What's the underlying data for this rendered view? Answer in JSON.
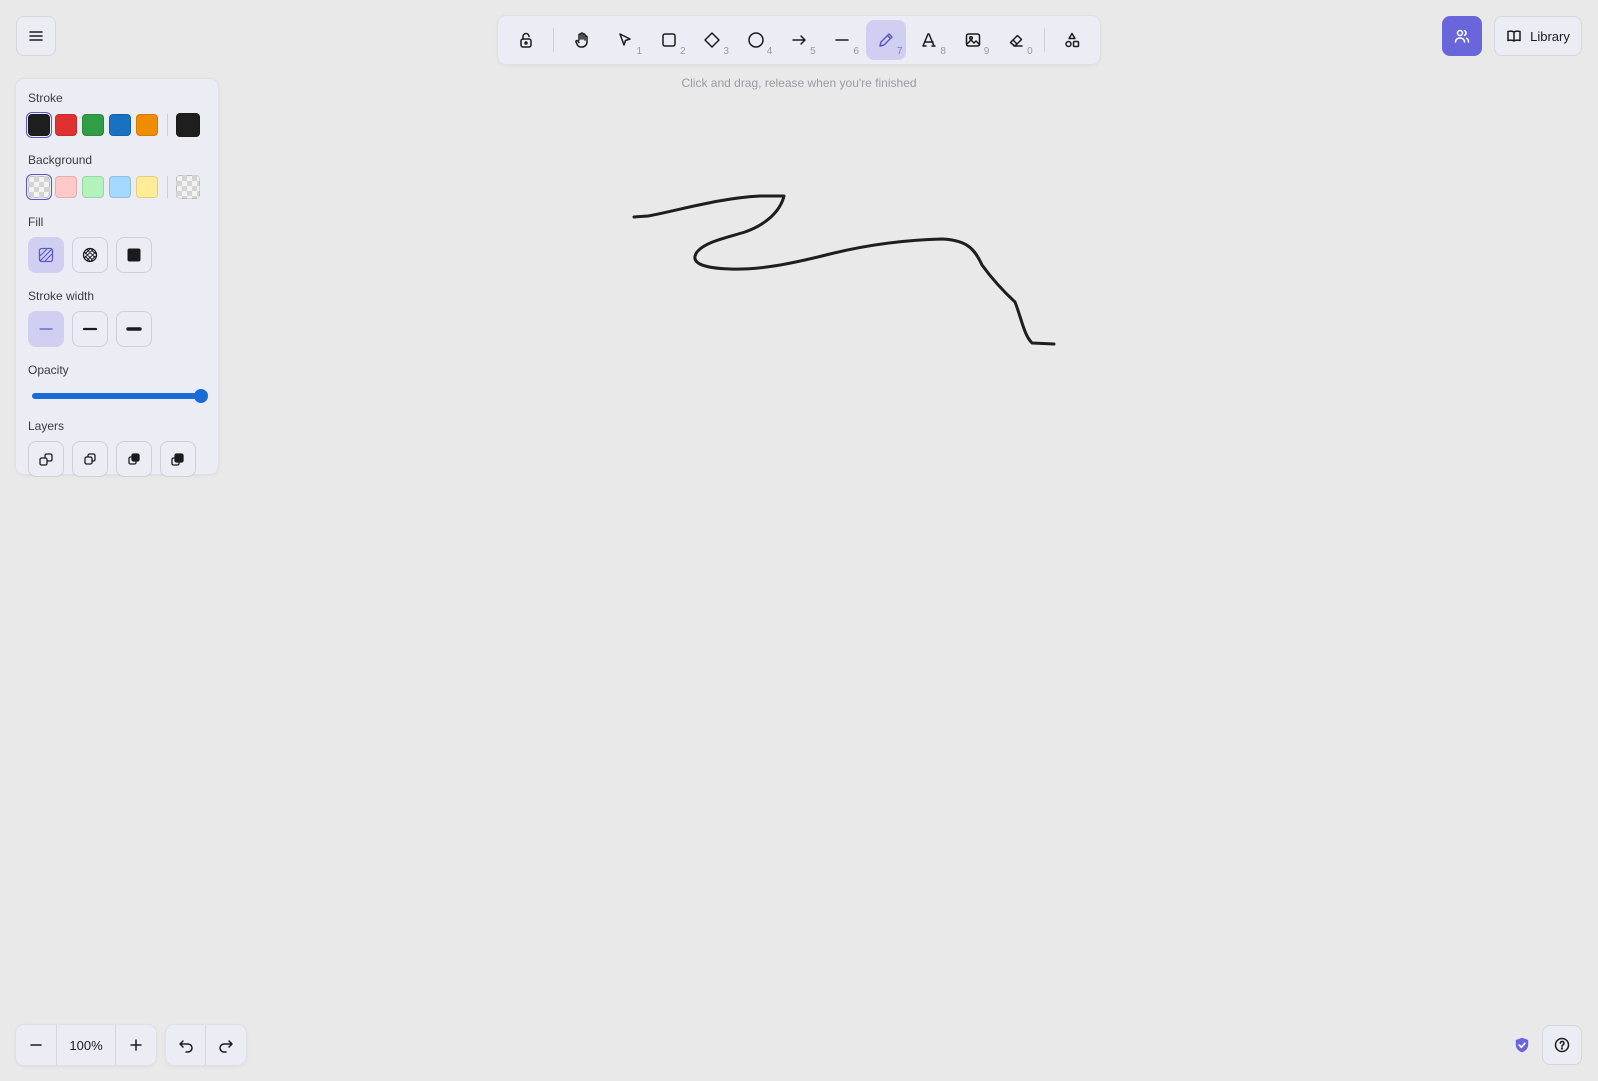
{
  "toolbar": {
    "tools": [
      {
        "name": "lock",
        "key": ""
      },
      {
        "name": "hand",
        "key": ""
      },
      {
        "name": "selection",
        "key": "1"
      },
      {
        "name": "rectangle",
        "key": "2"
      },
      {
        "name": "diamond",
        "key": "3"
      },
      {
        "name": "ellipse",
        "key": "4"
      },
      {
        "name": "arrow",
        "key": "5"
      },
      {
        "name": "line",
        "key": "6"
      },
      {
        "name": "draw",
        "key": "7",
        "active": true
      },
      {
        "name": "text",
        "key": "8"
      },
      {
        "name": "image",
        "key": "9"
      },
      {
        "name": "eraser",
        "key": "0"
      },
      {
        "name": "more-shapes",
        "key": ""
      }
    ],
    "hint": "Click and drag, release when you're finished"
  },
  "header": {
    "library_label": "Library",
    "collab_color": "#6965db"
  },
  "panel": {
    "stroke_label": "Stroke",
    "stroke_colors": [
      "#1e1e1e",
      "#e03131",
      "#2f9e44",
      "#1971c2",
      "#f08c00"
    ],
    "stroke_current": "#1e1e1e",
    "background_label": "Background",
    "background_colors": [
      "transparent",
      "#ffc9c9",
      "#b2f2bb",
      "#a5d8ff",
      "#ffec99"
    ],
    "background_current": "transparent",
    "fill_label": "Fill",
    "fill_options": [
      "hachure",
      "cross-hatch",
      "solid"
    ],
    "fill_selected": "hachure",
    "stroke_width_label": "Stroke width",
    "stroke_width_options": [
      "thin",
      "bold",
      "extra-bold"
    ],
    "stroke_width_selected": "thin",
    "opacity_label": "Opacity",
    "opacity_value": 100,
    "layers_label": "Layers",
    "layer_actions": [
      "send-to-back",
      "send-backward",
      "bring-forward",
      "bring-to-front"
    ]
  },
  "footer": {
    "zoom_level": "100%"
  }
}
